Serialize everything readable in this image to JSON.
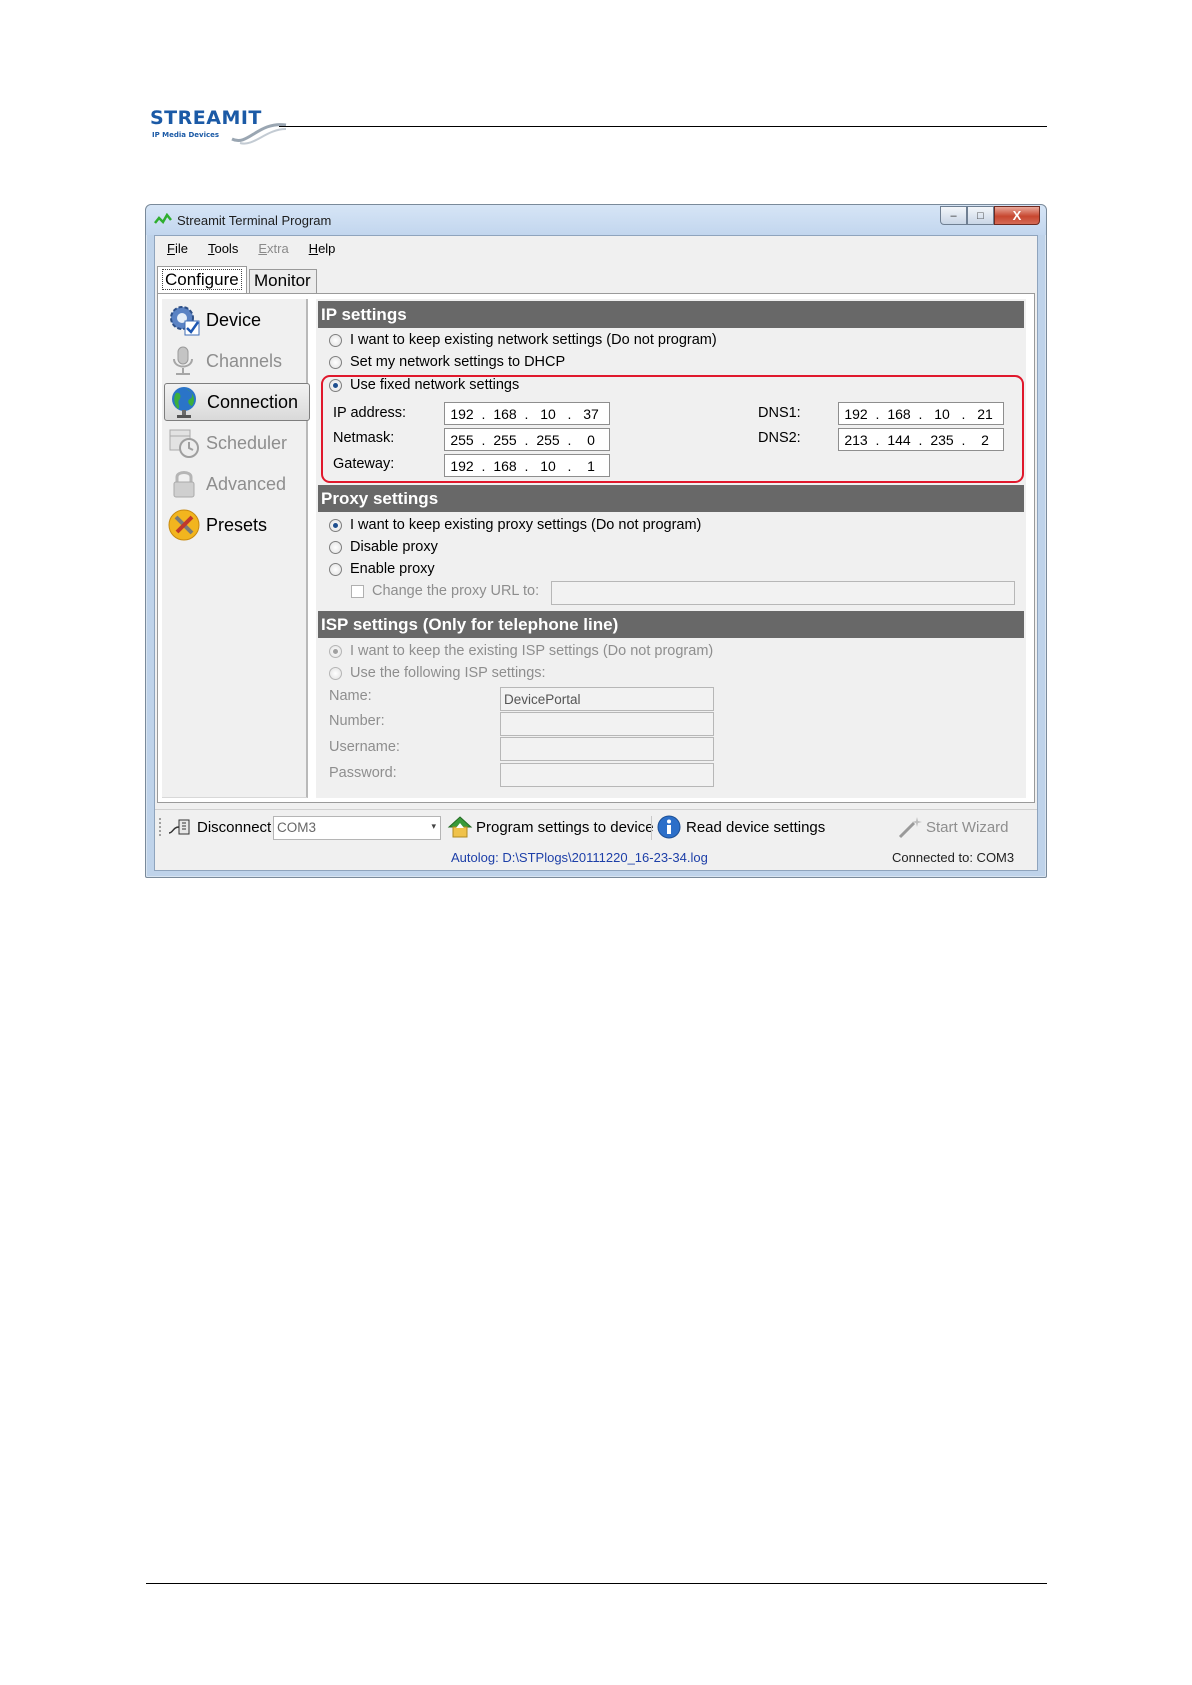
{
  "brand": {
    "logo_text": "STREAMIT",
    "logo_tagline": "IP Media Devices"
  },
  "window": {
    "title": "Streamit Terminal Program",
    "buttons": {
      "minimize": "–",
      "maximize": "□",
      "close": "X"
    }
  },
  "menu": [
    {
      "label": "File",
      "underline": "F",
      "rest": "ile",
      "enabled": true
    },
    {
      "label": "Tools",
      "underline": "T",
      "rest": "ools",
      "enabled": true
    },
    {
      "label": "Extra",
      "underline": "E",
      "rest": "xtra",
      "enabled": false
    },
    {
      "label": "Help",
      "underline": "H",
      "rest": "elp",
      "enabled": true
    }
  ],
  "tabs": {
    "configure": "Configure",
    "monitor": "Monitor",
    "active": "Configure"
  },
  "sidebar": {
    "items": [
      {
        "label": "Device",
        "icon": "gear-check-icon",
        "enabled": true
      },
      {
        "label": "Channels",
        "icon": "microphone-icon",
        "enabled": false
      },
      {
        "label": "Connection",
        "icon": "globe-icon",
        "enabled": true,
        "active": true
      },
      {
        "label": "Scheduler",
        "icon": "calendar-clock-icon",
        "enabled": false
      },
      {
        "label": "Advanced",
        "icon": "lock-icon",
        "enabled": false
      },
      {
        "label": "Presets",
        "icon": "tools-icon",
        "enabled": true
      }
    ]
  },
  "ip_settings": {
    "header": "IP settings",
    "options": [
      {
        "label": "I want to keep existing network settings (Do not program)",
        "checked": false
      },
      {
        "label": "Set my network settings to DHCP",
        "checked": false
      },
      {
        "label": "Use fixed network settings",
        "checked": true
      }
    ],
    "fields": {
      "ip_address": {
        "label": "IP address:",
        "octets": [
          "192",
          "168",
          "10",
          "37"
        ]
      },
      "netmask": {
        "label": "Netmask:",
        "octets": [
          "255",
          "255",
          "255",
          "0"
        ]
      },
      "gateway": {
        "label": "Gateway:",
        "octets": [
          "192",
          "168",
          "10",
          "1"
        ]
      },
      "dns1": {
        "label": "DNS1:",
        "octets": [
          "192",
          "168",
          "10",
          "21"
        ]
      },
      "dns2": {
        "label": "DNS2:",
        "octets": [
          "213",
          "144",
          "235",
          "2"
        ]
      }
    },
    "highlight_color": "#e0182c"
  },
  "proxy_settings": {
    "header": "Proxy settings",
    "options": [
      {
        "label": "I want to keep existing proxy settings (Do not program)",
        "checked": true
      },
      {
        "label": "Disable proxy",
        "checked": false
      },
      {
        "label": "Enable proxy",
        "checked": false
      }
    ],
    "change_url": {
      "label": "Change the proxy URL to:",
      "checked": false,
      "value": ""
    }
  },
  "isp_settings": {
    "header": "ISP settings (Only for telephone line)",
    "options": [
      {
        "label": "I want to keep the existing ISP settings (Do not program)",
        "checked": true
      },
      {
        "label": "Use the following ISP settings:",
        "checked": false
      }
    ],
    "fields": {
      "name": {
        "label": "Name:",
        "value": "DevicePortal"
      },
      "number": {
        "label": "Number:",
        "value": ""
      },
      "username": {
        "label": "Username:",
        "value": ""
      },
      "password": {
        "label": "Password:",
        "value": ""
      }
    }
  },
  "toolbar": {
    "disconnect": "Disconnect",
    "port": "COM3",
    "program": "Program settings to device",
    "read": "Read device settings",
    "wizard": "Start Wizard"
  },
  "status": {
    "autolog": "Autolog: D:\\STPlogs\\20111220_16-23-34.log",
    "connected": "Connected to: COM3"
  }
}
